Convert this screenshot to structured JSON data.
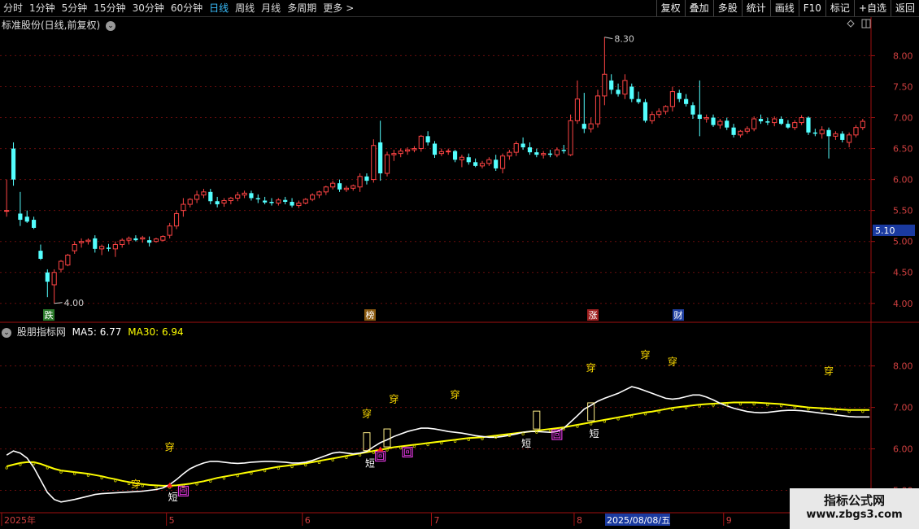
{
  "toolbar": {
    "periods": [
      "分时",
      "1分钟",
      "5分钟",
      "15分钟",
      "30分钟",
      "60分钟",
      "日线",
      "周线",
      "月线",
      "多周期",
      "更多"
    ],
    "active": "日线",
    "more_arrow": ">",
    "right_buttons": [
      "复权",
      "叠加",
      "多股",
      "统计",
      "画线",
      "F10",
      "标记",
      "+自选",
      "返回"
    ]
  },
  "main_panel": {
    "title": "标准股份(日线,前复权)",
    "price_axis": [
      "8.00",
      "7.50",
      "7.00",
      "6.50",
      "6.00",
      "5.50",
      "5.00",
      "4.50",
      "4.00"
    ],
    "current_price_label": "5.10",
    "high_marker": "8.30",
    "low_marker": "4.00",
    "event_tags": [
      {
        "text": "跌",
        "color": "#2a7a2a"
      },
      {
        "text": "榜",
        "color": "#8a5a10"
      },
      {
        "text": "涨",
        "color": "#a02020"
      },
      {
        "text": "财",
        "color": "#2040a0"
      }
    ],
    "colors": {
      "up": "#ff4444",
      "down": "#54ffff",
      "bg": "#000000",
      "grid": "#7a1010"
    }
  },
  "indicator_panel": {
    "name": "股朋指标网",
    "ma5_label": "MA5: 6.77",
    "ma30_label": "MA30: 6.94",
    "price_axis": [
      "8.00",
      "7.00",
      "6.00",
      "5.00"
    ],
    "marker_chuan": "穿",
    "marker_duan": "短",
    "marker_hui": "回",
    "colors": {
      "ma5": "#ffffff",
      "ma30": "#ffff00"
    }
  },
  "x_axis": {
    "labels": [
      "2025年",
      "5",
      "6",
      "7",
      "8",
      "9"
    ],
    "highlight_date": "2025/08/08/五"
  },
  "watermark": {
    "title": "指标公式网",
    "url": "www.zbgs3.com"
  },
  "chart_data": {
    "type": "candlestick",
    "y_range_main": [
      3.8,
      8.4
    ],
    "y_range_indicator": [
      4.5,
      8.7
    ],
    "ohlc": [
      [
        5.5,
        6.0,
        5.4,
        5.5
      ],
      [
        6.5,
        6.6,
        5.9,
        6.0
      ],
      [
        5.45,
        5.8,
        5.25,
        5.35
      ],
      [
        5.4,
        5.5,
        5.3,
        5.32
      ],
      [
        5.35,
        5.4,
        5.2,
        5.22
      ],
      [
        4.85,
        4.95,
        4.7,
        4.72
      ],
      [
        4.5,
        4.55,
        4.1,
        4.35
      ],
      [
        4.3,
        4.55,
        4.0,
        4.5
      ],
      [
        4.55,
        4.7,
        4.5,
        4.68
      ],
      [
        4.62,
        4.8,
        4.6,
        4.78
      ],
      [
        4.85,
        5.0,
        4.8,
        4.95
      ],
      [
        4.98,
        5.05,
        4.9,
        5.0
      ],
      [
        5.0,
        5.05,
        4.95,
        5.02
      ],
      [
        5.05,
        5.1,
        4.82,
        4.88
      ],
      [
        4.88,
        4.95,
        4.78,
        4.92
      ],
      [
        4.9,
        4.96,
        4.84,
        4.88
      ],
      [
        4.88,
        5.0,
        4.75,
        4.95
      ],
      [
        4.95,
        5.05,
        4.9,
        5.02
      ],
      [
        5.02,
        5.08,
        4.95,
        5.05
      ],
      [
        5.05,
        5.1,
        5.0,
        5.02
      ],
      [
        5.04,
        5.09,
        4.98,
        5.06
      ],
      [
        5.02,
        5.08,
        4.92,
        4.98
      ],
      [
        5.0,
        5.06,
        4.98,
        5.04
      ],
      [
        5.02,
        5.1,
        5.0,
        5.08
      ],
      [
        5.1,
        5.3,
        5.05,
        5.25
      ],
      [
        5.25,
        5.5,
        5.2,
        5.45
      ],
      [
        5.5,
        5.7,
        5.4,
        5.6
      ],
      [
        5.6,
        5.7,
        5.55,
        5.68
      ],
      [
        5.68,
        5.82,
        5.62,
        5.75
      ],
      [
        5.75,
        5.85,
        5.7,
        5.8
      ],
      [
        5.8,
        5.85,
        5.6,
        5.65
      ],
      [
        5.65,
        5.72,
        5.55,
        5.6
      ],
      [
        5.62,
        5.7,
        5.56,
        5.66
      ],
      [
        5.66,
        5.72,
        5.6,
        5.7
      ],
      [
        5.7,
        5.8,
        5.65,
        5.75
      ],
      [
        5.75,
        5.82,
        5.7,
        5.78
      ],
      [
        5.78,
        5.82,
        5.66,
        5.7
      ],
      [
        5.7,
        5.76,
        5.62,
        5.68
      ],
      [
        5.66,
        5.72,
        5.6,
        5.63
      ],
      [
        5.64,
        5.7,
        5.58,
        5.62
      ],
      [
        5.62,
        5.7,
        5.58,
        5.67
      ],
      [
        5.67,
        5.72,
        5.6,
        5.64
      ],
      [
        5.64,
        5.7,
        5.55,
        5.58
      ],
      [
        5.58,
        5.66,
        5.54,
        5.62
      ],
      [
        5.62,
        5.7,
        5.6,
        5.68
      ],
      [
        5.68,
        5.78,
        5.65,
        5.75
      ],
      [
        5.75,
        5.82,
        5.7,
        5.8
      ],
      [
        5.8,
        5.9,
        5.75,
        5.88
      ],
      [
        5.88,
        5.98,
        5.84,
        5.94
      ],
      [
        5.94,
        6.0,
        5.8,
        5.84
      ],
      [
        5.84,
        5.9,
        5.8,
        5.86
      ],
      [
        5.86,
        5.92,
        5.82,
        5.9
      ],
      [
        5.88,
        6.1,
        5.8,
        6.05
      ],
      [
        6.05,
        6.1,
        5.92,
        5.98
      ],
      [
        6.0,
        6.65,
        5.95,
        6.55
      ],
      [
        6.6,
        6.95,
        5.98,
        6.1
      ],
      [
        6.1,
        6.45,
        6.05,
        6.4
      ],
      [
        6.4,
        6.48,
        6.3,
        6.42
      ],
      [
        6.42,
        6.5,
        6.36,
        6.46
      ],
      [
        6.46,
        6.52,
        6.4,
        6.48
      ],
      [
        6.48,
        6.54,
        6.44,
        6.5
      ],
      [
        6.5,
        6.72,
        6.45,
        6.7
      ],
      [
        6.7,
        6.78,
        6.55,
        6.6
      ],
      [
        6.58,
        6.62,
        6.35,
        6.4
      ],
      [
        6.42,
        6.5,
        6.38,
        6.45
      ],
      [
        6.45,
        6.5,
        6.4,
        6.46
      ],
      [
        6.46,
        6.48,
        6.28,
        6.32
      ],
      [
        6.32,
        6.4,
        6.2,
        6.36
      ],
      [
        6.36,
        6.42,
        6.24,
        6.28
      ],
      [
        6.28,
        6.34,
        6.2,
        6.22
      ],
      [
        6.22,
        6.3,
        6.18,
        6.26
      ],
      [
        6.26,
        6.36,
        6.22,
        6.32
      ],
      [
        6.32,
        6.4,
        6.14,
        6.18
      ],
      [
        6.18,
        6.42,
        6.1,
        6.38
      ],
      [
        6.38,
        6.48,
        6.32,
        6.44
      ],
      [
        6.44,
        6.62,
        6.38,
        6.58
      ],
      [
        6.58,
        6.68,
        6.48,
        6.52
      ],
      [
        6.52,
        6.6,
        6.4,
        6.44
      ],
      [
        6.44,
        6.5,
        6.36,
        6.4
      ],
      [
        6.4,
        6.46,
        6.34,
        6.42
      ],
      [
        6.42,
        6.48,
        6.36,
        6.4
      ],
      [
        6.4,
        6.52,
        6.36,
        6.48
      ],
      [
        6.48,
        6.56,
        6.42,
        6.46
      ],
      [
        6.4,
        7.05,
        6.38,
        6.95
      ],
      [
        6.95,
        7.6,
        6.9,
        7.3
      ],
      [
        6.9,
        7.4,
        6.75,
        6.82
      ],
      [
        6.82,
        7.0,
        6.76,
        6.9
      ],
      [
        6.9,
        7.45,
        6.84,
        7.35
      ],
      [
        7.35,
        8.3,
        7.2,
        7.7
      ],
      [
        7.6,
        7.7,
        7.38,
        7.45
      ],
      [
        7.45,
        7.55,
        7.34,
        7.38
      ],
      [
        7.38,
        7.7,
        7.3,
        7.6
      ],
      [
        7.5,
        7.55,
        7.25,
        7.3
      ],
      [
        7.3,
        7.42,
        7.22,
        7.25
      ],
      [
        7.25,
        7.3,
        6.92,
        6.95
      ],
      [
        6.95,
        7.1,
        6.9,
        7.05
      ],
      [
        7.05,
        7.15,
        7.0,
        7.1
      ],
      [
        7.1,
        7.2,
        7.05,
        7.18
      ],
      [
        7.18,
        7.5,
        7.1,
        7.42
      ],
      [
        7.4,
        7.45,
        7.25,
        7.3
      ],
      [
        7.3,
        7.38,
        7.18,
        7.22
      ],
      [
        7.2,
        7.25,
        6.98,
        7.05
      ],
      [
        7.05,
        7.6,
        6.7,
        6.98
      ],
      [
        6.98,
        7.05,
        6.92,
        7.0
      ],
      [
        7.0,
        7.05,
        6.85,
        6.88
      ],
      [
        6.88,
        6.98,
        6.82,
        6.94
      ],
      [
        6.95,
        7.0,
        6.8,
        6.84
      ],
      [
        6.84,
        6.9,
        6.68,
        6.72
      ],
      [
        6.72,
        6.8,
        6.68,
        6.78
      ],
      [
        6.78,
        6.86,
        6.74,
        6.82
      ],
      [
        6.82,
        7.02,
        6.78,
        6.98
      ],
      [
        6.98,
        7.05,
        6.9,
        6.94
      ],
      [
        6.94,
        7.0,
        6.88,
        6.92
      ],
      [
        6.92,
        7.02,
        6.86,
        6.98
      ],
      [
        6.98,
        7.02,
        6.88,
        6.9
      ],
      [
        6.9,
        6.96,
        6.82,
        6.84
      ],
      [
        6.84,
        6.96,
        6.8,
        6.92
      ],
      [
        6.92,
        7.04,
        6.88,
        7.0
      ],
      [
        7.0,
        7.02,
        6.72,
        6.76
      ],
      [
        6.76,
        6.82,
        6.7,
        6.74
      ],
      [
        6.74,
        6.86,
        6.66,
        6.8
      ],
      [
        6.8,
        6.84,
        6.34,
        6.7
      ],
      [
        6.7,
        6.78,
        6.64,
        6.74
      ],
      [
        6.74,
        6.78,
        6.6,
        6.64
      ],
      [
        6.6,
        6.76,
        6.52,
        6.72
      ],
      [
        6.72,
        6.88,
        6.68,
        6.84
      ],
      [
        6.84,
        6.98,
        6.8,
        6.94
      ]
    ],
    "ma5_series": [
      5.85,
      5.95,
      5.9,
      5.78,
      5.55,
      5.25,
      4.95,
      4.78,
      4.72,
      4.75,
      4.78,
      4.82,
      4.86,
      4.9,
      4.92,
      4.93,
      4.94,
      4.95,
      4.96,
      4.97,
      4.98,
      5.0,
      5.02,
      5.06,
      5.14,
      5.26,
      5.4,
      5.52,
      5.6,
      5.66,
      5.7,
      5.7,
      5.68,
      5.66,
      5.65,
      5.66,
      5.68,
      5.69,
      5.7,
      5.7,
      5.69,
      5.68,
      5.66,
      5.66,
      5.68,
      5.72,
      5.78,
      5.84,
      5.9,
      5.92,
      5.9,
      5.88,
      5.9,
      5.94,
      6.05,
      6.15,
      6.22,
      6.3,
      6.36,
      6.42,
      6.46,
      6.5,
      6.5,
      6.48,
      6.45,
      6.42,
      6.4,
      6.38,
      6.35,
      6.32,
      6.3,
      6.28,
      6.28,
      6.3,
      6.33,
      6.36,
      6.4,
      6.42,
      6.42,
      6.41,
      6.4,
      6.42,
      6.5,
      6.65,
      6.8,
      6.96,
      7.05,
      7.15,
      7.22,
      7.28,
      7.34,
      7.42,
      7.5,
      7.46,
      7.4,
      7.34,
      7.28,
      7.22,
      7.2,
      7.22,
      7.26,
      7.3,
      7.3,
      7.25,
      7.18,
      7.1,
      7.04,
      6.98,
      6.94,
      6.9,
      6.88,
      6.87,
      6.88,
      6.9,
      6.92,
      6.93,
      6.93,
      6.92,
      6.9,
      6.88,
      6.86,
      6.84,
      6.82,
      6.8,
      6.78,
      6.77,
      6.77,
      6.77
    ],
    "ma30_series": [
      5.58,
      5.62,
      5.66,
      5.68,
      5.68,
      5.64,
      5.58,
      5.52,
      5.48,
      5.46,
      5.44,
      5.42,
      5.4,
      5.37,
      5.34,
      5.3,
      5.27,
      5.23,
      5.2,
      5.17,
      5.15,
      5.13,
      5.12,
      5.11,
      5.11,
      5.12,
      5.14,
      5.16,
      5.19,
      5.22,
      5.26,
      5.3,
      5.33,
      5.36,
      5.39,
      5.42,
      5.45,
      5.48,
      5.51,
      5.54,
      5.57,
      5.59,
      5.61,
      5.63,
      5.65,
      5.68,
      5.71,
      5.74,
      5.77,
      5.8,
      5.83,
      5.86,
      5.89,
      5.92,
      5.95,
      5.98,
      6.01,
      6.04,
      6.06,
      6.08,
      6.1,
      6.12,
      6.14,
      6.16,
      6.18,
      6.2,
      6.22,
      6.24,
      6.26,
      6.27,
      6.28,
      6.3,
      6.32,
      6.34,
      6.36,
      6.38,
      6.4,
      6.42,
      6.44,
      6.46,
      6.48,
      6.5,
      6.52,
      6.55,
      6.58,
      6.61,
      6.64,
      6.67,
      6.7,
      6.73,
      6.76,
      6.79,
      6.82,
      6.85,
      6.88,
      6.9,
      6.93,
      6.96,
      6.99,
      7.01,
      7.03,
      7.05,
      7.07,
      7.08,
      7.09,
      7.1,
      7.11,
      7.12,
      7.12,
      7.12,
      7.12,
      7.11,
      7.1,
      7.09,
      7.08,
      7.06,
      7.04,
      7.02,
      7.0,
      6.99,
      6.98,
      6.97,
      6.96,
      6.95,
      6.94,
      6.94,
      6.94,
      6.94
    ]
  }
}
